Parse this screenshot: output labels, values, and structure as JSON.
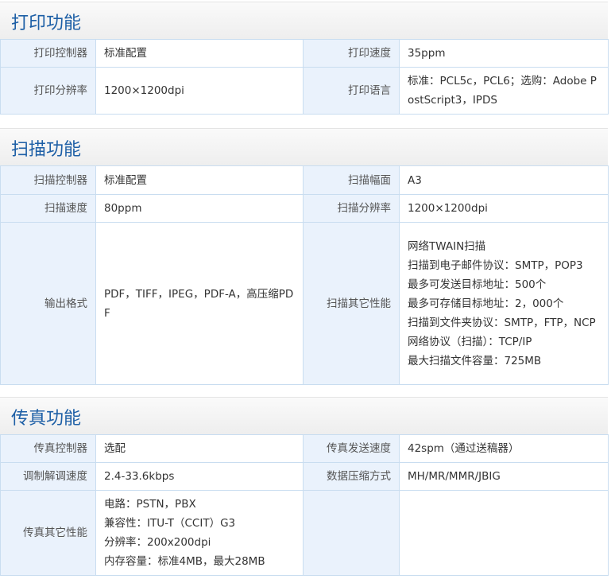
{
  "print": {
    "title": "打印功能",
    "rows": [
      [
        {
          "label": "打印控制器",
          "value": "标准配置"
        },
        {
          "label": "打印速度",
          "value": "35ppm"
        }
      ],
      [
        {
          "label": "打印分辨率",
          "value": "1200×1200dpi"
        },
        {
          "label": "打印语言",
          "value": "标准：PCL5c，PCL6；选购：Adobe PostScript3，IPDS"
        }
      ]
    ]
  },
  "scan": {
    "title": "扫描功能",
    "rows": [
      [
        {
          "label": "扫描控制器",
          "value": "标准配置"
        },
        {
          "label": "扫描幅面",
          "value": "A3"
        }
      ],
      [
        {
          "label": "扫描速度",
          "value": "80ppm"
        },
        {
          "label": "扫描分辨率",
          "value": "1200×1200dpi"
        }
      ]
    ],
    "output_label": "输出格式",
    "output_value": "PDF，TIFF，IPEG，PDF-A，高压缩PDF",
    "other_label": "扫描其它性能",
    "other_lines": [
      "网络TWAIN扫描",
      "扫描到电子邮件协议：SMTP，POP3",
      "最多可发送目标地址：500个",
      "最多可存储目标地址：2，000个",
      "扫描到文件夹协议：SMTP，FTP，NCP",
      "网络协议（扫描）：TCP/IP",
      "最大扫描文件容量：725MB"
    ]
  },
  "fax": {
    "title": "传真功能",
    "rows": [
      [
        {
          "label": "传真控制器",
          "value": "选配"
        },
        {
          "label": "传真发送速度",
          "value": "42spm（通过送稿器）"
        }
      ],
      [
        {
          "label": "调制解调速度",
          "value": "2.4-33.6kbps"
        },
        {
          "label": "数据压缩方式",
          "value": "MH/MR/MMR/JBIG"
        }
      ]
    ],
    "other_label": "传真其它性能",
    "other_lines": [
      "电路：PSTN，PBX",
      "兼容性：ITU-T（CCIT）G3",
      "分辨率：200x200dpi",
      "内存容量：标准4MB，最大28MB"
    ]
  }
}
